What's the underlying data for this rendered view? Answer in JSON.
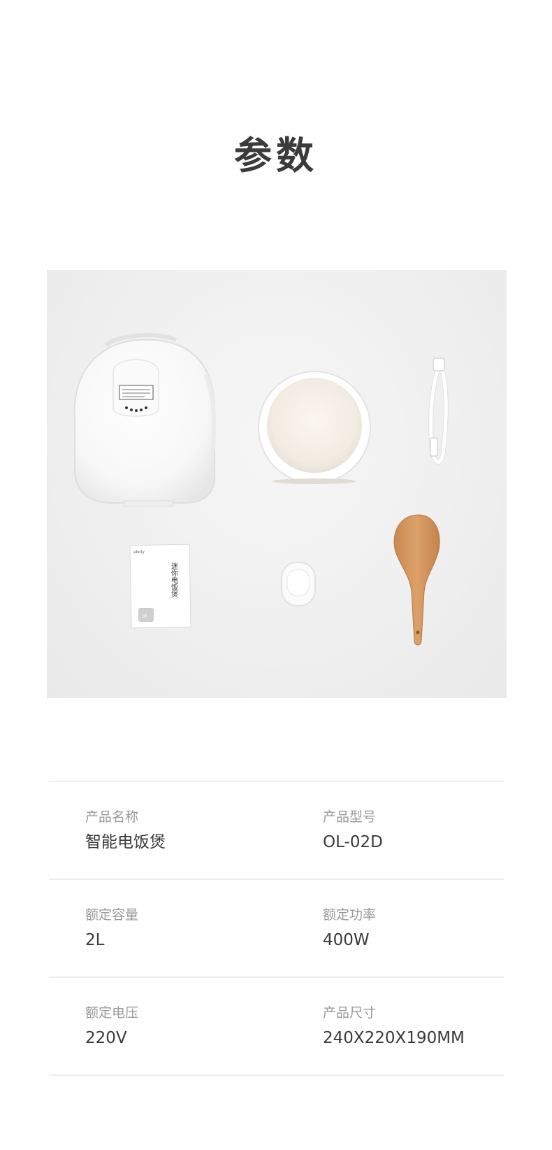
{
  "header": {
    "title": "参数"
  },
  "photo": {
    "manual_cover_title": "迷你电饭煲",
    "manual_brand": "ekoly",
    "manual_logo": "ol"
  },
  "specs": [
    {
      "left": {
        "label": "产品名称",
        "value": "智能电饭煲"
      },
      "right": {
        "label": "产品型号",
        "value": "OL-02D"
      }
    },
    {
      "left": {
        "label": "额定容量",
        "value": "2L"
      },
      "right": {
        "label": "额定功率",
        "value": "400W"
      }
    },
    {
      "left": {
        "label": "额定电压",
        "value": "220V"
      },
      "right": {
        "label": "产品尺寸",
        "value": "240X220X190MM"
      }
    }
  ]
}
